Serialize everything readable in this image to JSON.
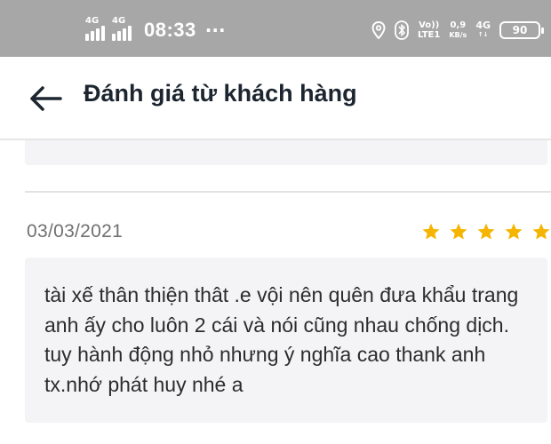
{
  "status_bar": {
    "sim1_label": "4G",
    "sim2_label": "4G",
    "time": "08:33",
    "overflow": "···",
    "volte_top": "Vo))",
    "volte_bottom": "LTE1",
    "speed_value": "0,9",
    "speed_unit": "KB/s",
    "net_label": "4G",
    "net_sub": "↑↓",
    "battery": "90",
    "icons": [
      "location-icon",
      "bluetooth-icon",
      "battery-icon"
    ]
  },
  "header": {
    "back_icon": "arrow-left-icon",
    "title": "Đánh giá từ khách hàng"
  },
  "review": {
    "date": "03/03/2021",
    "rating": 5,
    "rating_max": 5,
    "text": "tài xế thân thiện thât .e vội nên quên đưa khẩu trang anh ấy cho luôn 2 cái và nói cũng nhau chống dịch. tuy hành động nhỏ nhưng ý nghĩa cao thank anh tx.nhớ phát huy nhé a"
  },
  "colors": {
    "status_bar_bg": "#a7a7a7",
    "title_text": "#1d2630",
    "star": "#f5b400",
    "review_bg": "#f4f4f6",
    "date_text": "#707070"
  }
}
